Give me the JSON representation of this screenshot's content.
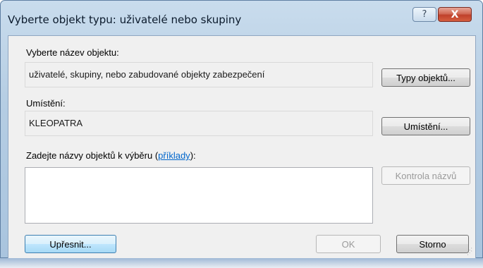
{
  "window": {
    "title": "Vyberte objekt typu: uživatelé nebo skupiny",
    "help_label": "?",
    "close_label": "X"
  },
  "object_type": {
    "label": "Vyberte název objektu:",
    "value": "uživatelé, skupiny, nebo zabudované objekty zabezpečení",
    "button": "Typy objektů..."
  },
  "location": {
    "label": "Umístění:",
    "value": "KLEOPATRA",
    "button": "Umístění..."
  },
  "names": {
    "label_prefix": "Zadejte názvy objektů k výběru (",
    "label_link": "příklady",
    "label_suffix": "):",
    "value": "",
    "check_button": "Kontrola názvů"
  },
  "footer": {
    "advanced_button": "Upřesnit...",
    "ok_button": "OK",
    "cancel_button": "Storno"
  }
}
